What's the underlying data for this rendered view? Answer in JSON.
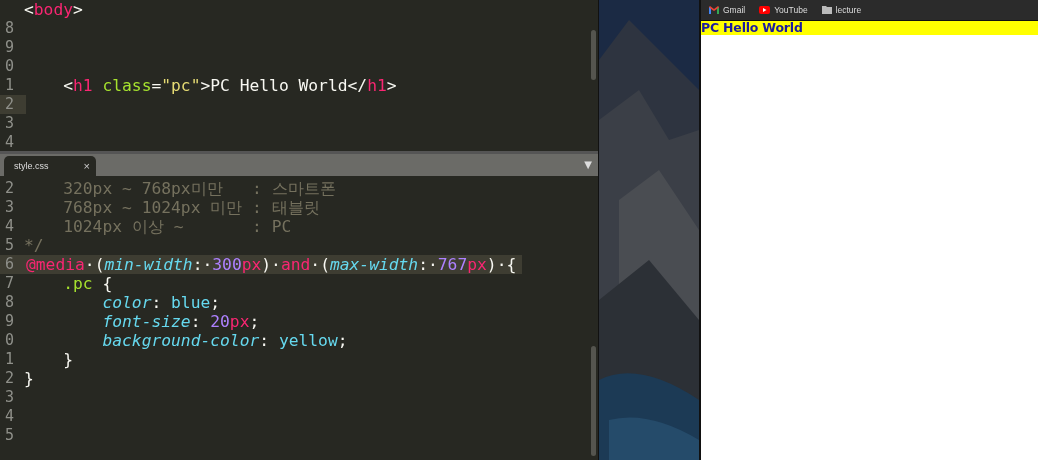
{
  "editor": {
    "top_pane": {
      "lines": [
        {
          "current": false,
          "tokens": [
            {
              "text": "<",
              "kind": "punct"
            },
            {
              "text": "body",
              "kind": "tag"
            },
            {
              "text": ">",
              "kind": "punct"
            }
          ]
        },
        {
          "number": "8",
          "current": false
        },
        {
          "number": "9",
          "current": false
        },
        {
          "number": "0",
          "current": false
        },
        {
          "number": "1",
          "current": false,
          "tokens": [
            {
              "text": "    <",
              "kind": "punct"
            },
            {
              "text": "h1",
              "kind": "tag"
            },
            {
              "text": " class",
              "kind": "attr"
            },
            {
              "text": "=",
              "kind": "punct"
            },
            {
              "text": "\"pc\"",
              "kind": "string"
            },
            {
              "text": ">PC Hello World</",
              "kind": "punct"
            },
            {
              "text": "h1",
              "kind": "tag"
            },
            {
              "text": ">",
              "kind": "punct"
            }
          ]
        },
        {
          "number": "2",
          "current": true
        },
        {
          "number": "3",
          "current": false
        },
        {
          "number": "4",
          "current": false
        }
      ]
    },
    "tab": {
      "label": "style.css",
      "close": "×",
      "selected": true
    },
    "dropdown": "▼",
    "bottom_pane": {
      "lines": [
        {
          "number": "2",
          "current": false,
          "tokens": [
            {
              "text": "    320px ~ 768px미만   : 스마트폰",
              "kind": "comment"
            }
          ]
        },
        {
          "number": "3",
          "current": false,
          "tokens": [
            {
              "text": "    768px ~ 1024px 미만 : 태블릿",
              "kind": "comment"
            }
          ]
        },
        {
          "number": "4",
          "current": false,
          "tokens": [
            {
              "text": "    1024px 이상 ~       : PC",
              "kind": "comment"
            }
          ]
        },
        {
          "number": "5",
          "current": false,
          "tokens": [
            {
              "text": "*/",
              "kind": "comment"
            }
          ]
        },
        {
          "number": "6",
          "current": true,
          "tokens": [
            {
              "text": "@media",
              "kind": "keyword"
            },
            {
              "text": "·(",
              "kind": "punct"
            },
            {
              "text": "min-width",
              "kind": "property"
            },
            {
              "text": ":·",
              "kind": "punct"
            },
            {
              "text": "300",
              "kind": "number"
            },
            {
              "text": "px",
              "kind": "keyword"
            },
            {
              "text": ")·",
              "kind": "punct"
            },
            {
              "text": "and",
              "kind": "keyword"
            },
            {
              "text": "·(",
              "kind": "punct"
            },
            {
              "text": "max-width",
              "kind": "property"
            },
            {
              "text": ":·",
              "kind": "punct"
            },
            {
              "text": "767",
              "kind": "number"
            },
            {
              "text": "px",
              "kind": "keyword"
            },
            {
              "text": ")·{",
              "kind": "punct"
            }
          ]
        },
        {
          "number": "7",
          "current": false,
          "tokens": [
            {
              "text": "    .pc",
              "kind": "attr"
            },
            {
              "text": " {",
              "kind": "punct"
            }
          ]
        },
        {
          "number": "8",
          "current": false,
          "tokens": [
            {
              "text": "        color",
              "kind": "property"
            },
            {
              "text": ": ",
              "kind": "punct"
            },
            {
              "text": "blue",
              "kind": "value"
            },
            {
              "text": ";",
              "kind": "punct"
            }
          ]
        },
        {
          "number": "9",
          "current": false,
          "tokens": [
            {
              "text": "        font-size",
              "kind": "property"
            },
            {
              "text": ": ",
              "kind": "punct"
            },
            {
              "text": "20",
              "kind": "number"
            },
            {
              "text": "px",
              "kind": "keyword"
            },
            {
              "text": ";",
              "kind": "punct"
            }
          ]
        },
        {
          "number": "0",
          "current": false,
          "tokens": [
            {
              "text": "        background-color",
              "kind": "property"
            },
            {
              "text": ": ",
              "kind": "punct"
            },
            {
              "text": "yellow",
              "kind": "value"
            },
            {
              "text": ";",
              "kind": "punct"
            }
          ]
        },
        {
          "number": "1",
          "current": false,
          "tokens": [
            {
              "text": "    }",
              "kind": "punct"
            }
          ]
        },
        {
          "number": "2",
          "current": false,
          "tokens": [
            {
              "text": "}",
              "kind": "punct"
            }
          ]
        },
        {
          "number": "3",
          "current": false
        },
        {
          "number": "4",
          "current": false
        },
        {
          "number": "5",
          "current": false
        }
      ]
    }
  },
  "browser": {
    "bookmarks": [
      {
        "label": "Gmail",
        "kind": "gmail"
      },
      {
        "label": "YouTube",
        "kind": "youtube"
      },
      {
        "label": "lecture",
        "kind": "folder"
      }
    ],
    "heading": "PC Hello World"
  }
}
